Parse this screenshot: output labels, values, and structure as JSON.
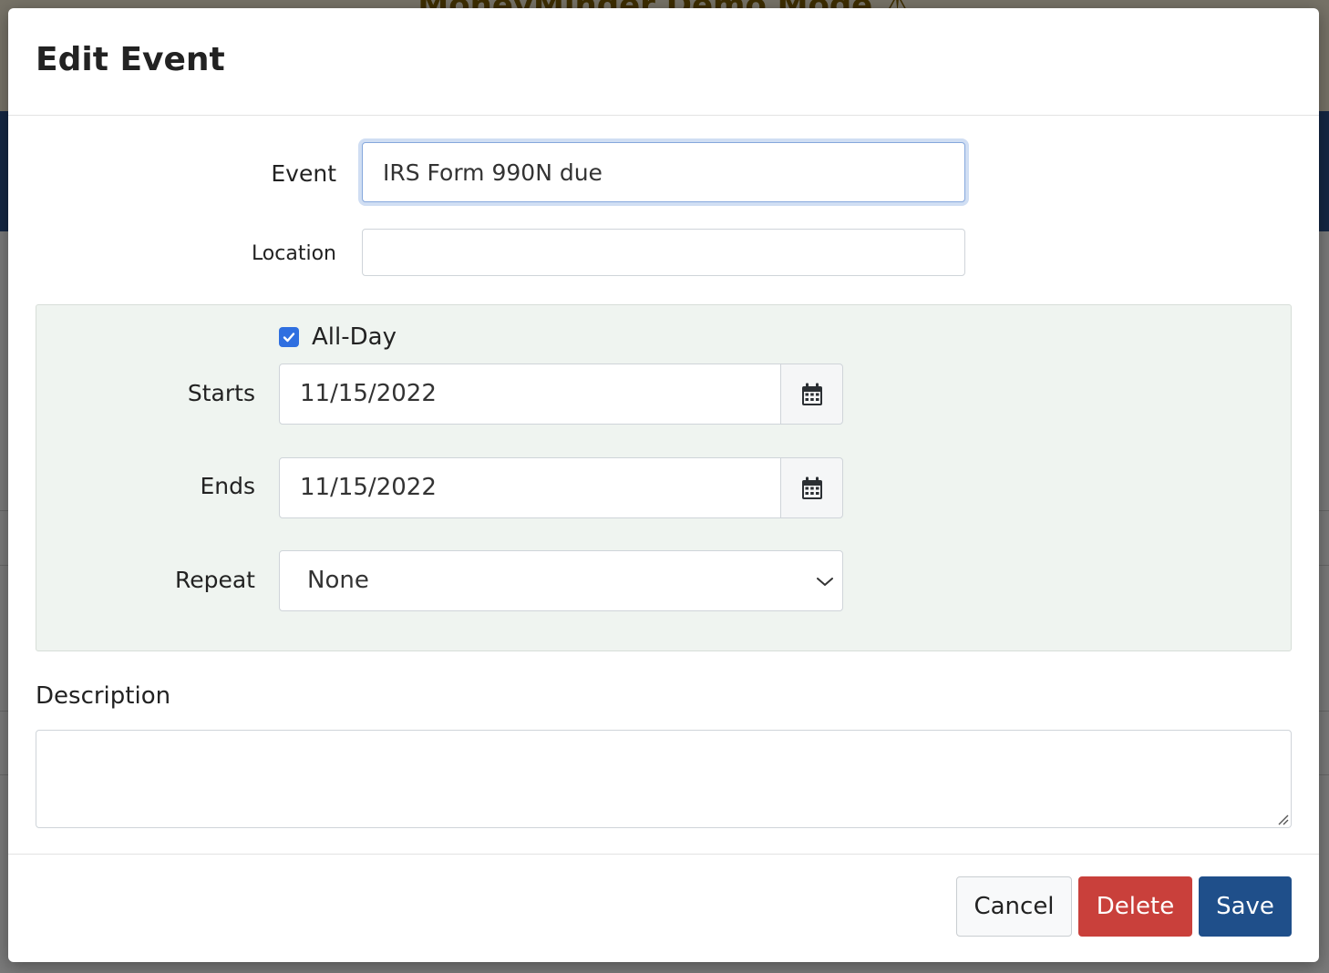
{
  "background": {
    "banner_text": "MoneyMinder Demo Mode ⚠"
  },
  "modal": {
    "title": "Edit Event",
    "event": {
      "label": "Event",
      "value": "IRS Form 990N due"
    },
    "location": {
      "label": "Location",
      "value": ""
    },
    "all_day": {
      "label": "All-Day",
      "checked": true
    },
    "starts": {
      "label": "Starts",
      "value": "11/15/2022"
    },
    "ends": {
      "label": "Ends",
      "value": "11/15/2022"
    },
    "repeat": {
      "label": "Repeat",
      "selected": "None"
    },
    "description": {
      "label": "Description",
      "value": ""
    },
    "buttons": {
      "cancel": "Cancel",
      "delete": "Delete",
      "save": "Save"
    }
  },
  "colors": {
    "primary": "#1f4f8a",
    "danger": "#c9403b",
    "checkbox": "#2f6fe0",
    "panel_bg": "#eff4f0"
  },
  "icons": {
    "calendar": "calendar-icon",
    "chevron": "chevron-down-icon",
    "check": "check-icon",
    "resize": "resize-handle-icon"
  }
}
